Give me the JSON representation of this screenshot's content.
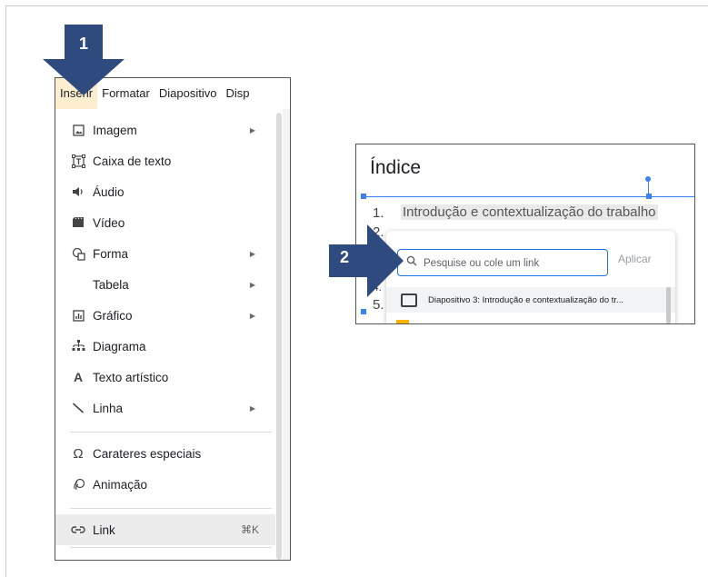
{
  "callouts": {
    "step1": "1",
    "step2": "2"
  },
  "menubar": {
    "items": [
      {
        "label": "Inserir",
        "active": true
      },
      {
        "label": "Formatar",
        "active": false
      },
      {
        "label": "Diapositivo",
        "active": false
      },
      {
        "label": "Disp",
        "active": false
      }
    ]
  },
  "insert_menu": {
    "items": [
      {
        "label": "Imagem",
        "icon": "image-icon",
        "submenu": true
      },
      {
        "label": "Caixa de texto",
        "icon": "text-box-icon",
        "submenu": false
      },
      {
        "label": "Áudio",
        "icon": "audio-icon",
        "submenu": false
      },
      {
        "label": "Vídeo",
        "icon": "video-icon",
        "submenu": false
      },
      {
        "label": "Forma",
        "icon": "shape-icon",
        "submenu": true
      },
      {
        "label": "Tabela",
        "icon": "",
        "submenu": true
      },
      {
        "label": "Gráfico",
        "icon": "chart-icon",
        "submenu": true
      },
      {
        "label": "Diagrama",
        "icon": "diagram-icon",
        "submenu": false
      },
      {
        "label": "Texto artístico",
        "icon": "word-art-icon",
        "submenu": false
      },
      {
        "label": "Linha",
        "icon": "line-icon",
        "submenu": true
      },
      {
        "label": "Carateres especiais",
        "icon": "omega-icon",
        "submenu": false
      },
      {
        "label": "Animação",
        "icon": "animation-icon",
        "submenu": false
      },
      {
        "label": "Link",
        "icon": "link-icon",
        "submenu": false,
        "shortcut": "⌘K",
        "highlighted": true
      }
    ]
  },
  "slide": {
    "title": "Índice",
    "list_numbers": [
      "1.",
      "2.",
      "4.",
      "5."
    ],
    "item1_text": "Introdução e contextualização do trabalho"
  },
  "link_popup": {
    "search_placeholder": "Pesquise ou cole um link",
    "apply_label": "Aplicar",
    "result": "Diapositivo 3: Introdução e contextualização do tr..."
  },
  "colors": {
    "callout": "#2e4a7f",
    "active_menu": "#fdeed0",
    "selection": "#3b82f6",
    "search_border": "#1a73e8"
  }
}
